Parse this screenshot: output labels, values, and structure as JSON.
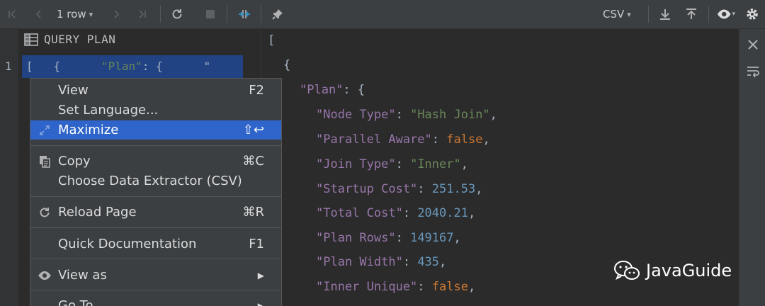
{
  "toolbar": {
    "row_count": "1 row",
    "format": "CSV"
  },
  "left_pane": {
    "header": "QUERY PLAN",
    "row_number": "1",
    "cell_prefix": "[   {      ",
    "cell_str": "\"Plan\"",
    "cell_suffix": ": {      \""
  },
  "context_menu": {
    "items": [
      {
        "label": "View",
        "shortcut": "F2"
      },
      {
        "label": "Set Language...",
        "shortcut": ""
      },
      {
        "label": "Maximize",
        "shortcut": "⇧↩"
      },
      {
        "label": "Copy",
        "shortcut": "⌘C"
      },
      {
        "label": "Choose Data Extractor (CSV)",
        "shortcut": ""
      },
      {
        "label": "Reload Page",
        "shortcut": "⌘R"
      },
      {
        "label": "Quick Documentation",
        "shortcut": "F1"
      },
      {
        "label": "View as",
        "shortcut": ""
      },
      {
        "label": "Go To",
        "shortcut": ""
      }
    ]
  },
  "editor": {
    "open_bracket": "[",
    "open_brace": "{",
    "plan_key": "\"Plan\"",
    "plan_rest": ": {",
    "fields": [
      {
        "key": "\"Node Type\"",
        "value": "\"Hash Join\"",
        "type": "string"
      },
      {
        "key": "\"Parallel Aware\"",
        "value": "false",
        "type": "bool"
      },
      {
        "key": "\"Join Type\"",
        "value": "\"Inner\"",
        "type": "string"
      },
      {
        "key": "\"Startup Cost\"",
        "value": "251.53",
        "type": "number"
      },
      {
        "key": "\"Total Cost\"",
        "value": "2040.21",
        "type": "number"
      },
      {
        "key": "\"Plan Rows\"",
        "value": "149167",
        "type": "number"
      },
      {
        "key": "\"Plan Width\"",
        "value": "435",
        "type": "number"
      },
      {
        "key": "\"Inner Unique\"",
        "value": "false",
        "type": "bool"
      }
    ]
  },
  "watermark": {
    "text": "JavaGuide"
  },
  "colors": {
    "selection": "#2f65ca",
    "cell_selection": "#214283",
    "json_key": "#9876aa",
    "json_string": "#6a8759",
    "json_number": "#6897bb",
    "json_keyword": "#cc7832"
  }
}
